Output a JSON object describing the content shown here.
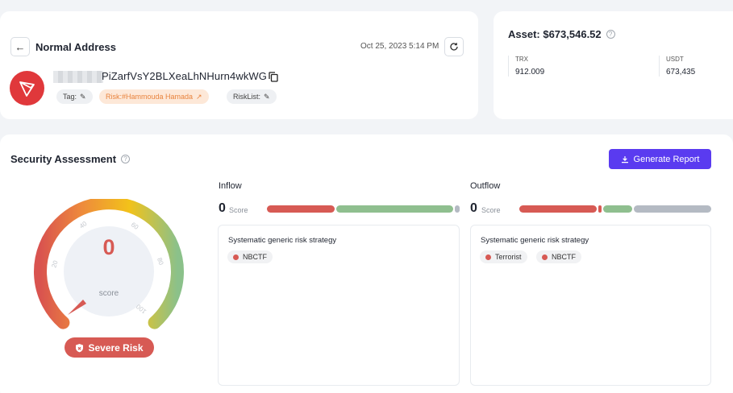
{
  "address_card": {
    "title": "Normal Address",
    "timestamp": "Oct 25, 2023 5:14 PM",
    "address_visible": "PiZarfVsY2BLXeaLhNHurn4wkWG",
    "tag_label": "Tag:",
    "risk_label": "Risk:#Hammouda Hamada",
    "risklist_label": "RiskList:"
  },
  "asset_card": {
    "title": "Asset: $673,546.52",
    "assets": [
      {
        "symbol": "TRX",
        "amount": "912.009"
      },
      {
        "symbol": "USDT",
        "amount": "673,435"
      }
    ]
  },
  "security": {
    "title": "Security Assessment",
    "generate_button": "Generate Report",
    "gauge": {
      "score": "0",
      "score_label": "score",
      "ticks": [
        "20",
        "40",
        "60",
        "80",
        "100"
      ],
      "badge": "Severe Risk"
    },
    "inflow": {
      "label": "Inflow",
      "score": "0",
      "score_label": "Score",
      "panel_title": "Systematic generic risk strategy",
      "tags": [
        "NBCTF"
      ]
    },
    "outflow": {
      "label": "Outflow",
      "score": "0",
      "score_label": "Score",
      "panel_title": "Systematic generic risk strategy",
      "tags": [
        "Terrorist",
        "NBCTF"
      ]
    }
  },
  "colors": {
    "accent": "#5a3bf0",
    "risk_red": "#d75a54",
    "safe_green": "#8fbf8f",
    "neutral_gray": "#b4bac3",
    "tron_red": "#e0383b"
  }
}
